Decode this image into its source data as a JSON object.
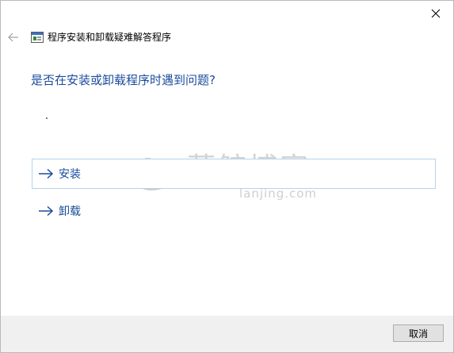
{
  "window": {
    "title": "程序安装和卸载疑难解答程序"
  },
  "main": {
    "question": "是否在安装或卸载程序时遇到问题?",
    "options": [
      {
        "label": "安装",
        "icon": "arrow-right-icon"
      },
      {
        "label": "卸载",
        "icon": "arrow-right-icon"
      }
    ]
  },
  "watermark": {
    "text": "蓝鲸博客",
    "sub": "lanjing.com"
  },
  "footer": {
    "cancel_label": "取消"
  },
  "colors": {
    "link_blue": "#1a4c9c",
    "selected_border": "#b5d3ee",
    "footer_bg": "#f0f0f0"
  }
}
